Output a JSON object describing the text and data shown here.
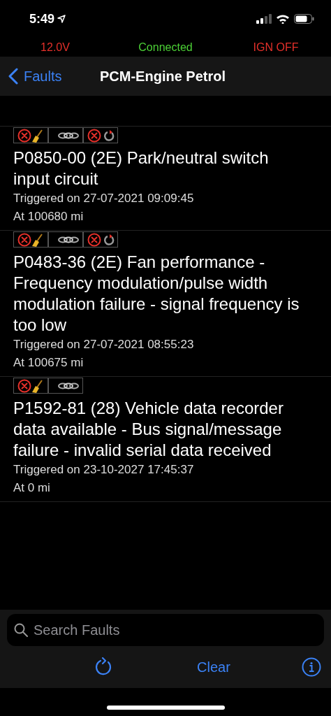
{
  "status_bar": {
    "time": "5:49"
  },
  "readings": [
    {
      "text": "12.0V",
      "color": "#e5302a"
    },
    {
      "text": "Connected",
      "color": "#4cd136"
    },
    {
      "text": "IGN OFF",
      "color": "#e5302a"
    }
  ],
  "nav": {
    "back": "Faults",
    "title": "PCM-Engine Petrol"
  },
  "faults": [
    {
      "flags": [
        {
          "kind": "clearable"
        },
        {
          "kind": "linked"
        },
        {
          "kind": "pending"
        }
      ],
      "title": "P0850-00 (2E) Park/neutral switch input circuit",
      "triggered": "Triggered on 27-07-2021 09:09:45",
      "mileage": "At 100680 mi"
    },
    {
      "flags": [
        {
          "kind": "clearable"
        },
        {
          "kind": "linked"
        },
        {
          "kind": "pending"
        }
      ],
      "title": "P0483-36 (2E) Fan performance - Frequency modulation/pulse width modulation failure - signal frequency is too low",
      "triggered": "Triggered on 27-07-2021 08:55:23",
      "mileage": "At 100675 mi"
    },
    {
      "flags": [
        {
          "kind": "clearable"
        },
        {
          "kind": "linked"
        }
      ],
      "title": "P1592-81 (28) Vehicle data recorder data available - Bus signal/message failure - invalid serial data received",
      "triggered": "Triggered on 23-10-2027 17:45:37",
      "mileage": "At 0 mi"
    }
  ],
  "search": {
    "placeholder": "Search Faults"
  },
  "toolbar": {
    "clear": "Clear"
  }
}
